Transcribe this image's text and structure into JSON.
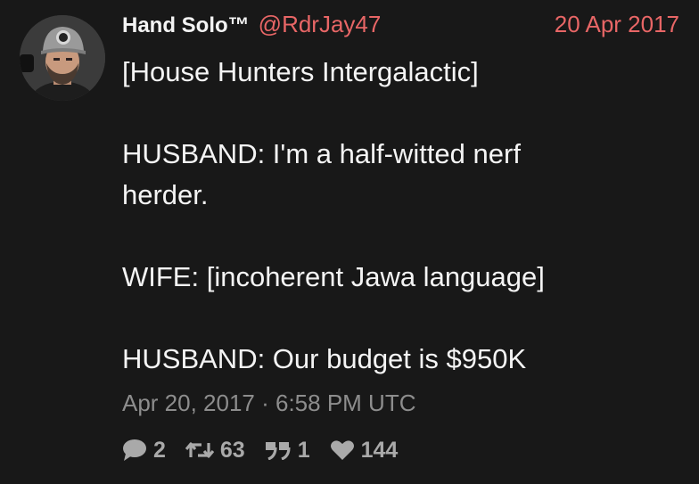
{
  "tweet": {
    "author": {
      "fullname": "Hand Solo™",
      "username": "@RdrJay47"
    },
    "date": "20 Apr 2017",
    "content": {
      "lines": [
        "[House Hunters Intergalactic]",
        "",
        "HUSBAND: I'm a half-witted nerf",
        "herder.",
        "",
        "WIFE: [incoherent Jawa language]",
        "",
        "HUSBAND: Our budget is $950K"
      ]
    },
    "published": "Apr 20, 2017 · 6:58 PM UTC",
    "stats": {
      "comments": "2",
      "retweets": "63",
      "quotes": "1",
      "likes": "144"
    },
    "icons": {
      "comment": "speech-bubble-icon",
      "retweet": "retweet-icon",
      "quote": "quote-icon",
      "like": "heart-icon"
    },
    "colors": {
      "background": "#181818",
      "accent": "#e86666",
      "muted": "#8d8d8d",
      "text": "#f4f4f4"
    }
  }
}
